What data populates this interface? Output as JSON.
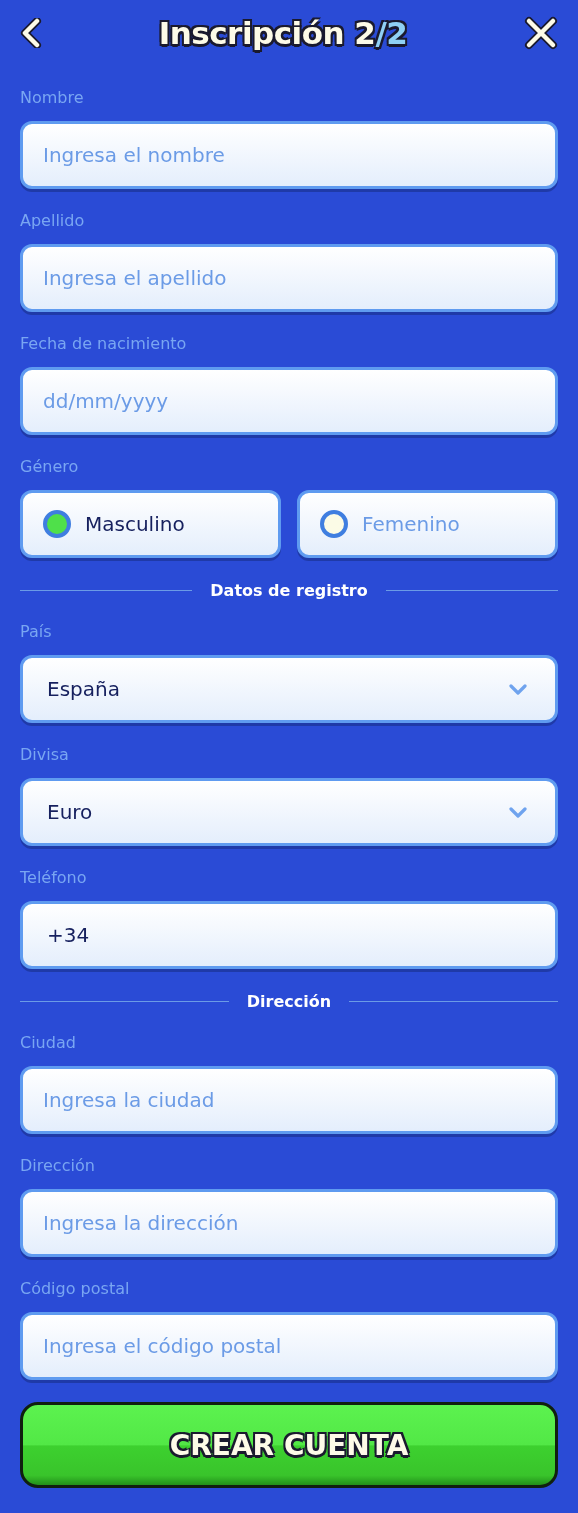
{
  "header": {
    "title": "Inscripción 2",
    "title_step": "/2"
  },
  "form": [
    {
      "kind": "text",
      "label": "Nombre",
      "placeholder": "Ingresa el nombre"
    },
    {
      "kind": "text",
      "label": "Apellido",
      "placeholder": "Ingresa el apellido"
    },
    {
      "kind": "text",
      "label": "Fecha de nacimiento",
      "placeholder": "dd/mm/yyyy"
    },
    {
      "kind": "radio",
      "label": "Género",
      "options": [
        {
          "label": "Masculino",
          "selected": true
        },
        {
          "label": "Femenino",
          "selected": false
        }
      ]
    },
    {
      "kind": "divider",
      "label": "Datos de registro"
    },
    {
      "kind": "select",
      "label": "País",
      "value": "España"
    },
    {
      "kind": "select",
      "label": "Divisa",
      "value": "Euro"
    },
    {
      "kind": "value",
      "label": "Teléfono",
      "value": "+34"
    },
    {
      "kind": "divider",
      "label": "Dirección"
    },
    {
      "kind": "text",
      "label": "Ciudad",
      "placeholder": "Ingresa la ciudad"
    },
    {
      "kind": "text",
      "label": "Dirección",
      "placeholder": "Ingresa la dirección"
    },
    {
      "kind": "text",
      "label": "Código postal",
      "placeholder": "Ingresa el código postal"
    }
  ],
  "submit": {
    "label": "CREAR CUENTA"
  }
}
